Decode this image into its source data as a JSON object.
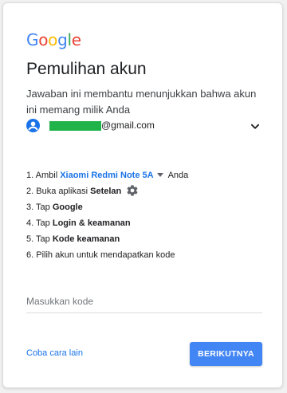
{
  "logo": {
    "letters": [
      "G",
      "o",
      "o",
      "g",
      "l",
      "e"
    ],
    "colors": [
      "#4285f4",
      "#ea4335",
      "#fbbc05",
      "#4285f4",
      "#34a853",
      "#ea4335"
    ]
  },
  "title": "Pemulihan akun",
  "subtitle": "Jawaban ini membantu menunjukkan bahwa akun ini memang milik Anda",
  "account": {
    "email_suffix": "@gmail.com",
    "avatar_icon": "account-circle-icon",
    "expand_icon": "chevron-down-icon",
    "redaction_color": "#1fb34a"
  },
  "steps": [
    {
      "num": "1.",
      "pre": "Ambil ",
      "device": "Xiaomi Redmi Note 5A",
      "post": "Anda"
    },
    {
      "num": "2.",
      "pre": "Buka aplikasi ",
      "bold": "Setelan",
      "icon": "gear-icon"
    },
    {
      "num": "3.",
      "pre": "Tap ",
      "bold": "Google"
    },
    {
      "num": "4.",
      "pre": "Tap ",
      "bold": "Login & keamanan"
    },
    {
      "num": "5.",
      "pre": "Tap ",
      "bold": "Kode keamanan"
    },
    {
      "num": "6.",
      "pre": "Pilih akun untuk mendapatkan kode"
    }
  ],
  "code_input": {
    "placeholder": "Masukkan kode",
    "value": ""
  },
  "links": {
    "try_another": "Coba cara lain"
  },
  "buttons": {
    "next": "BERIKUTNYA"
  },
  "colors": {
    "accent": "#1a73e8",
    "button": "#4285f4"
  }
}
